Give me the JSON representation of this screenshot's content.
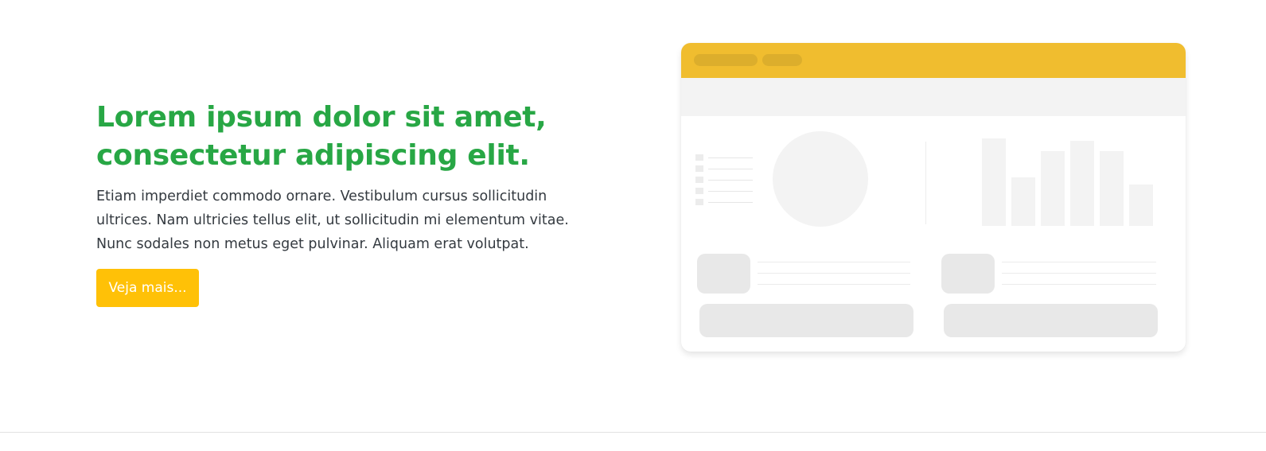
{
  "hero": {
    "title": "Lorem ipsum dolor sit amet, consectetur adipiscing elit.",
    "description": "Etiam imperdiet commodo ornare. Vestibulum cursus sollicitudin ultrices. Nam ultricies tellus elit, ut sollicitudin mi elementum vitae. Nunc sodales non metus eget pulvinar. Aliquam erat volutpat.",
    "cta_label": "Veja mais..."
  },
  "colors": {
    "title": "#28a745",
    "cta_background": "#ffc107",
    "illustration_header": "#f0bd2f"
  },
  "illustration": {
    "semantic": "dashboard-mockup-illustration",
    "bar_levels": [
      1.0,
      0.55,
      0.85,
      0.97,
      0.85,
      0.47
    ]
  }
}
